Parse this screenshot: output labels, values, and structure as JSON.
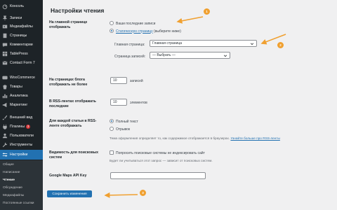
{
  "sidebar": {
    "items": [
      {
        "label": "Консоль",
        "icon": "dashboard-icon"
      },
      {
        "label": "Записи",
        "icon": "pin-icon"
      },
      {
        "label": "Медиафайлы",
        "icon": "media-icon"
      },
      {
        "label": "Страницы",
        "icon": "page-icon"
      },
      {
        "label": "Комментарии",
        "icon": "comment-icon"
      },
      {
        "label": "TablePress",
        "icon": "table-icon"
      },
      {
        "label": "Contact Form 7",
        "icon": "mail-icon"
      },
      {
        "label": "WooCommerce",
        "icon": "woo-icon"
      },
      {
        "label": "Товары",
        "icon": "product-icon"
      },
      {
        "label": "Аналитика",
        "icon": "analytics-icon"
      },
      {
        "label": "Маркетинг",
        "icon": "megaphone-icon"
      },
      {
        "label": "Внешний вид",
        "icon": "brush-icon"
      },
      {
        "label": "Плагины",
        "icon": "plugin-icon",
        "badge": "3"
      },
      {
        "label": "Пользователи",
        "icon": "user-icon"
      },
      {
        "label": "Инструменты",
        "icon": "wrench-icon"
      },
      {
        "label": "Настройки",
        "icon": "settings-icon",
        "active": true
      }
    ],
    "submenu": [
      "Общие",
      "Написание",
      "Чтение",
      "Обсуждение",
      "Медиафайлы",
      "Постоянные ссылки"
    ],
    "current_sub": "Чтение"
  },
  "page": {
    "title": "Настройки чтения",
    "homepage": {
      "label": "На главной странице отображать",
      "option_latest": "Ваши последние записи",
      "option_static_link": "Статическую страницу",
      "option_static_suffix": " (выберите ниже)",
      "front_page_label": "Главная страница:",
      "front_page_value": "Главная страница",
      "posts_page_label": "Страница записей:",
      "posts_page_value": "— Выбрать —"
    },
    "posts_per_page": {
      "label": "На страницах блога отображать не более",
      "value": "10",
      "unit": "записей"
    },
    "rss_items": {
      "label": "В RSS-лентах отображать последние",
      "value": "10",
      "unit": "элементов"
    },
    "rss_content": {
      "label": "Для каждой статьи в RSS-ленте отображать",
      "option_full": "Полный текст",
      "option_excerpt": "Отрывок",
      "desc_prefix": "Тема оформления определяет то, как содержимое отображается в браузерах. ",
      "desc_link": "Узнайте больше про RSS-ленты"
    },
    "search_visibility": {
      "label": "Видимость для поисковых систем",
      "checkbox_label": "Попросить поисковые системы не индексировать сайт",
      "desc": "Будет ли учитываться этот запрос — зависит от поисковых систем."
    },
    "gmaps": {
      "label": "Google Maps API Key",
      "value": ""
    },
    "save_label": "Сохранить изменения"
  },
  "annotations": [
    "1",
    "2",
    "3"
  ],
  "colors": {
    "accent": "#2271b1",
    "sidebar": "#1d2327",
    "annotation": "#f0a030"
  }
}
